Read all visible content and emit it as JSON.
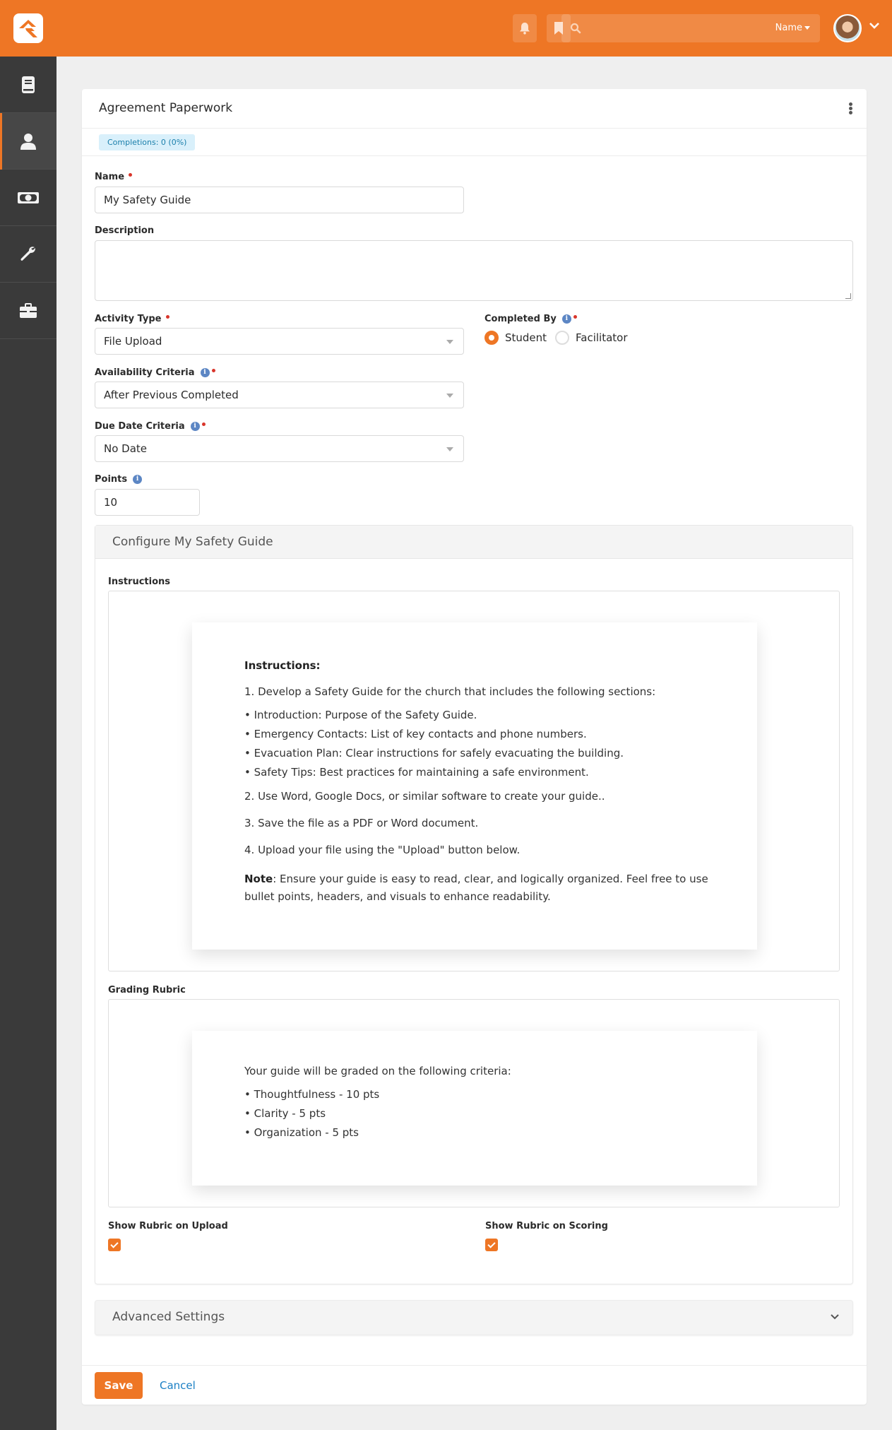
{
  "topbar": {
    "search_placeholder": "",
    "search_scope": "Name",
    "brand_color": "#ee7625"
  },
  "sidebar": {
    "items": [
      {
        "icon": "book-icon",
        "active": false
      },
      {
        "icon": "person-icon",
        "active": true
      },
      {
        "icon": "money-icon",
        "active": false
      },
      {
        "icon": "wrench-icon",
        "active": false
      },
      {
        "icon": "briefcase-icon",
        "active": false
      }
    ]
  },
  "card": {
    "title": "Agreement Paperwork",
    "completions_badge": "Completions: 0 (0%)"
  },
  "form": {
    "name": {
      "label": "Name",
      "value": "My Safety Guide",
      "required": true
    },
    "description": {
      "label": "Description",
      "value": ""
    },
    "activity_type": {
      "label": "Activity Type",
      "value": "File Upload",
      "required": true
    },
    "completed_by": {
      "label": "Completed By",
      "required": true,
      "options": [
        {
          "label": "Student",
          "selected": true
        },
        {
          "label": "Facilitator",
          "selected": false
        }
      ]
    },
    "availability_criteria": {
      "label": "Availability Criteria",
      "value": "After Previous Completed",
      "required": true
    },
    "due_date_criteria": {
      "label": "Due Date Criteria",
      "value": "No Date",
      "required": true
    },
    "points": {
      "label": "Points",
      "value": "10"
    }
  },
  "configure": {
    "title": "Configure My Safety Guide",
    "instructions_label": "Instructions",
    "instructions": {
      "heading": "Instructions:",
      "step1": "1. Develop a Safety Guide for the church that includes the following sections:",
      "bullets": [
        "• Introduction: Purpose of the Safety Guide.",
        "• Emergency Contacts: List of key contacts and phone numbers.",
        "• Evacuation Plan: Clear instructions for safely evacuating the building.",
        "• Safety Tips: Best practices for maintaining a safe environment."
      ],
      "step2": "2. Use Word, Google Docs, or similar software to create your guide..",
      "step3": "3. Save the file as a PDF or Word document.",
      "step4": "4. Upload your file using the \"Upload\" button below.",
      "note_label": "Note",
      "note_text": ": Ensure your guide is easy to read, clear, and logically organized. Feel free to use bullet points, headers, and visuals to enhance readability."
    },
    "rubric_label": "Grading Rubric",
    "rubric": {
      "intro": "Your guide will be graded on the following criteria:",
      "bullets": [
        "• Thoughtfulness - 10 pts",
        "• Clarity - 5 pts",
        "• Organization - 5 pts"
      ]
    },
    "show_rubric_upload": {
      "label": "Show Rubric on Upload",
      "checked": true
    },
    "show_rubric_scoring": {
      "label": "Show Rubric on Scoring",
      "checked": true
    }
  },
  "advanced": {
    "title": "Advanced Settings"
  },
  "footer": {
    "save_label": "Save",
    "cancel_label": "Cancel"
  }
}
